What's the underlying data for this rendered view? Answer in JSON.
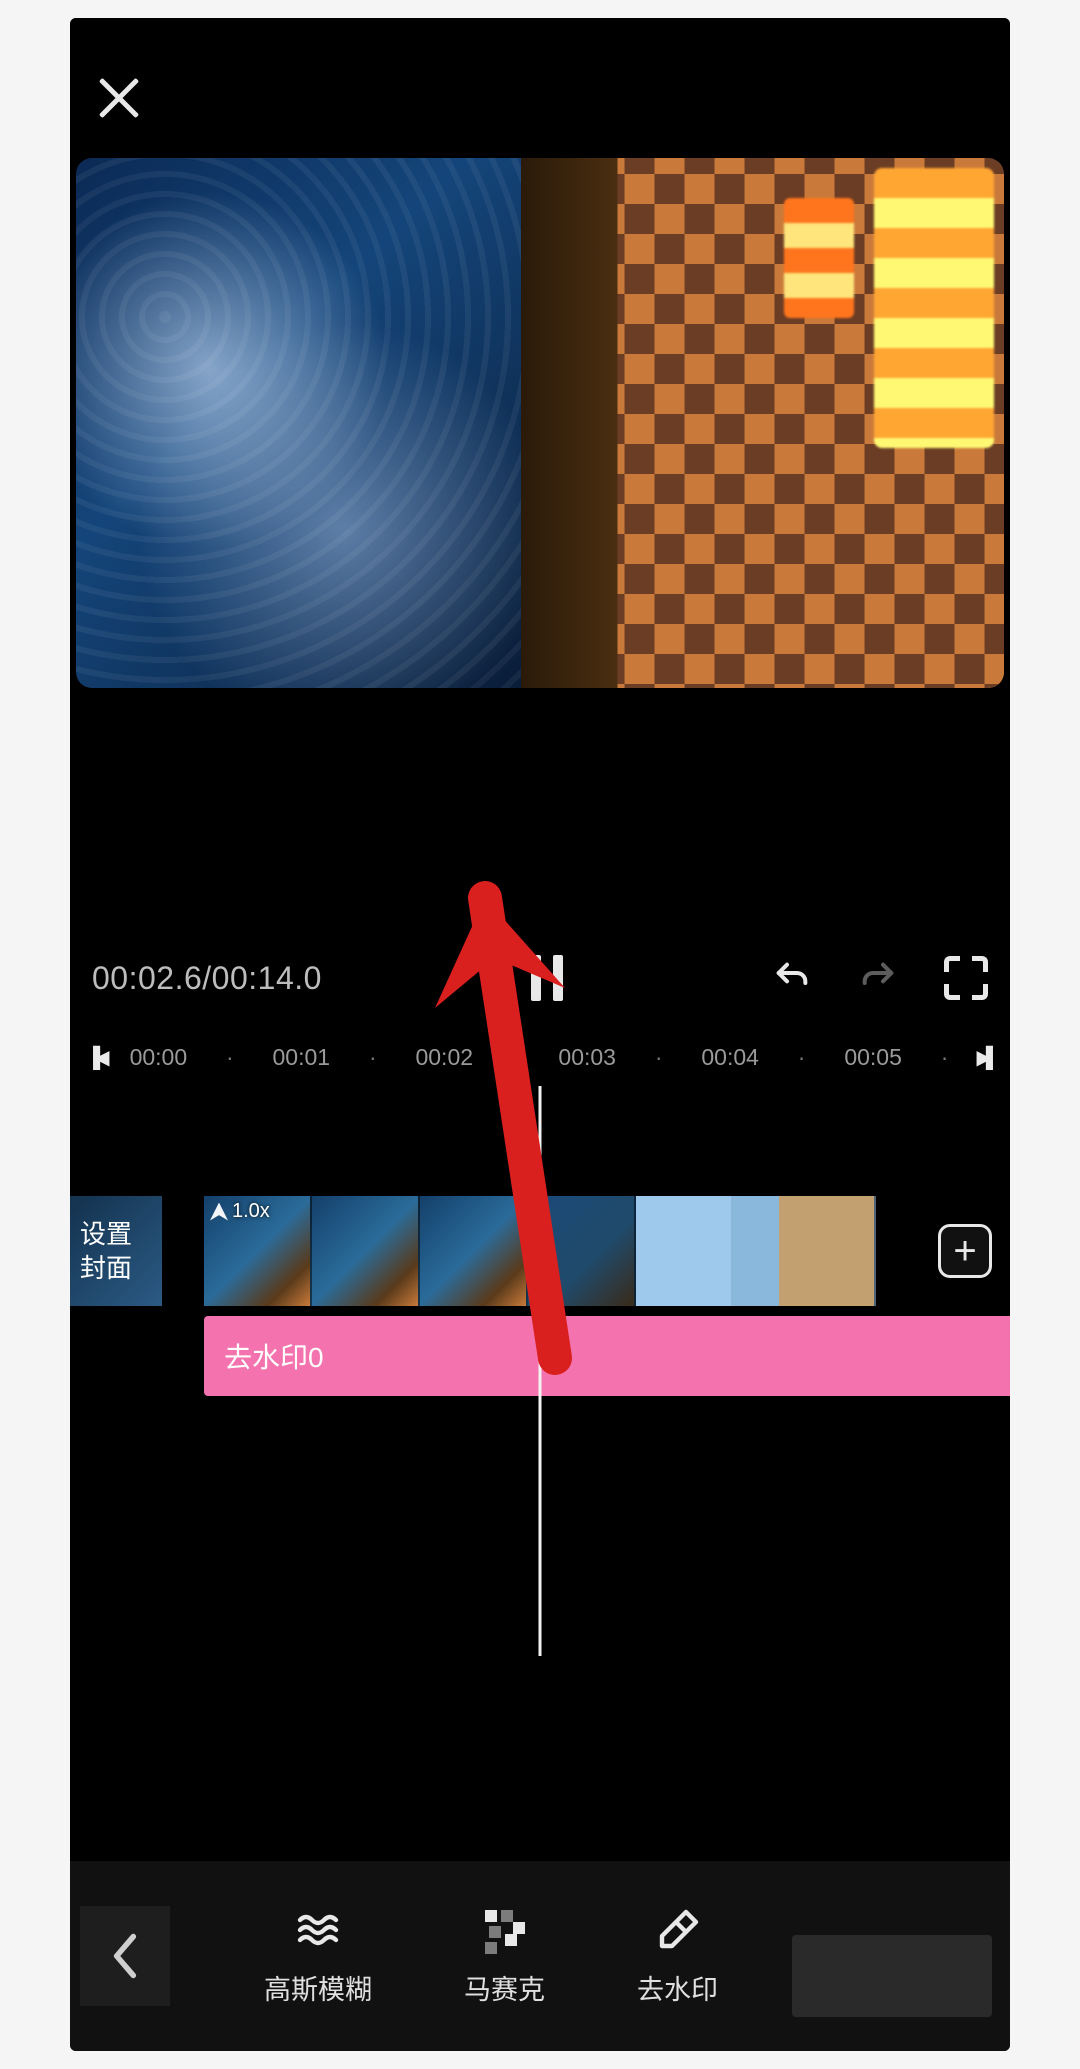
{
  "playback": {
    "current_time": "00:02.6",
    "total_time": "00:14.0",
    "separator": "/"
  },
  "ruler": {
    "ticks": [
      "00:00",
      "00:01",
      "00:02",
      "00:03",
      "00:04",
      "00:05"
    ]
  },
  "timeline": {
    "cover_button_line1": "设置",
    "cover_button_line2": "封面",
    "speed_badge": "1.0x",
    "add_button": "+",
    "effect_label": "去水印0"
  },
  "toolbar": {
    "gaussian_blur": "高斯模糊",
    "mosaic": "马赛克",
    "remove_watermark": "去水印"
  },
  "colors": {
    "effect_bar": "#f472ad",
    "arrow": "#d9201f"
  }
}
